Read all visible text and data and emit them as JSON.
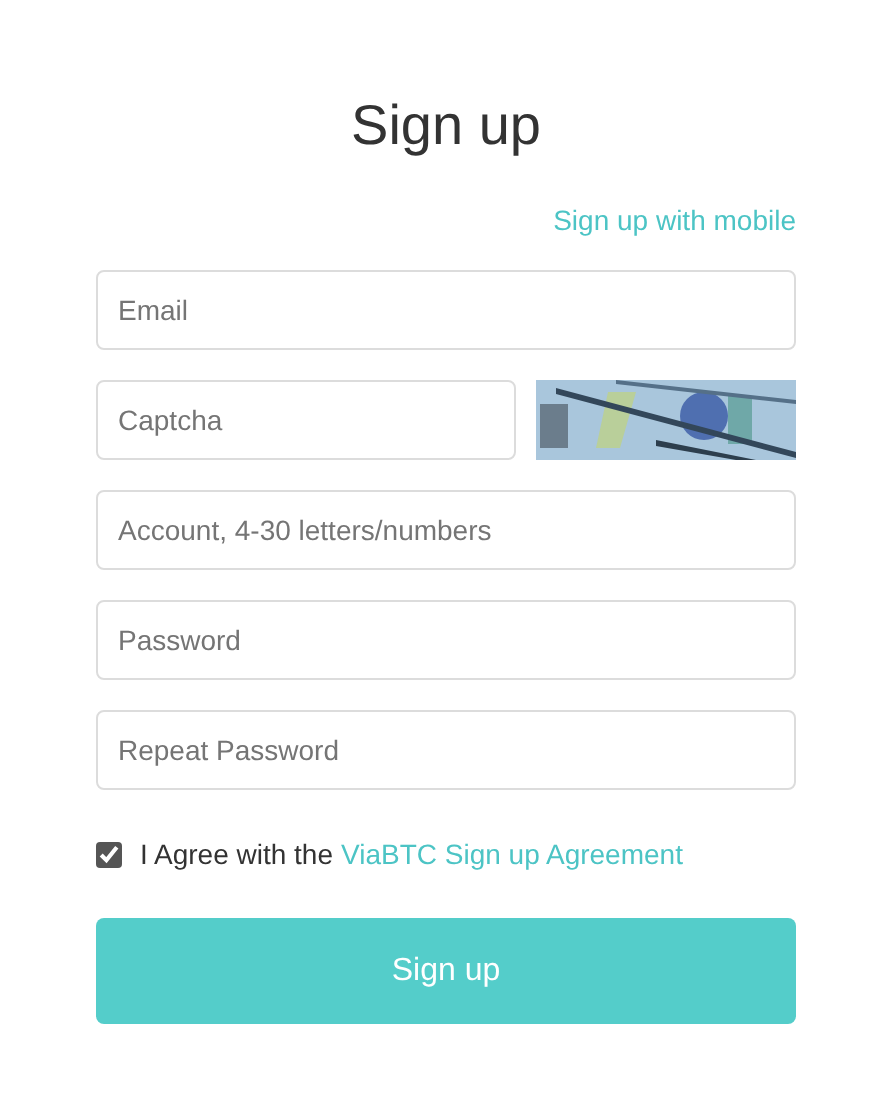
{
  "title": "Sign up",
  "mobile_link": "Sign up with mobile",
  "fields": [
    {
      "kind": "text",
      "placeholder": "Email"
    },
    {
      "kind": "captcha",
      "placeholder": "Captcha"
    },
    {
      "kind": "text",
      "placeholder": "Account, 4-30 letters/numbers"
    },
    {
      "kind": "password",
      "placeholder": "Password"
    },
    {
      "kind": "password",
      "placeholder": "Repeat Password"
    }
  ],
  "agreement": {
    "checked": true,
    "text": "I Agree with the",
    "link": "ViaBTC Sign up Agreement"
  },
  "submit": "Sign up"
}
